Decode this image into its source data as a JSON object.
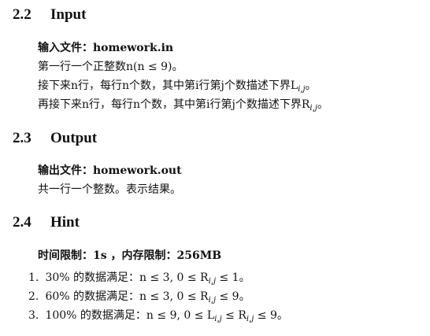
{
  "input": {
    "heading_num": "2.2",
    "heading_title": "Input",
    "file_label": "输入文件：homework.in",
    "line1": "第一行一个正整数n(n ≤ 9)。",
    "line2": "接下来n行，每行n个数，其中第i行第j个数描述下界L",
    "line2_sub": "i,j",
    "line2_end": "。",
    "line3": "再接下来n行，每行n个数，其中第i行第j个数描述下界R",
    "line3_sub": "i,j",
    "line3_end": "。"
  },
  "output": {
    "heading_num": "2.3",
    "heading_title": "Output",
    "file_label": "输出文件：homework.out",
    "line1": "共一行一个整数。表示结果。"
  },
  "hint": {
    "heading_num": "2.4",
    "heading_title": "Hint",
    "limits": "时间限制：1s ，内存限制：256MB",
    "items": [
      {
        "num": "1.",
        "pre": "30% 的数据满足：n ≤ 3, 0 ≤ R",
        "sub": "i,j",
        "post": " ≤ 1。"
      },
      {
        "num": "2.",
        "pre": "60% 的数据满足：n ≤ 3, 0 ≤ R",
        "sub": "i,j",
        "post": " ≤ 9。"
      },
      {
        "num": "3.",
        "pre": "100% 的数据满足：n ≤ 9, 0 ≤ L",
        "sub": "i,j",
        "mid": " ≤ R",
        "sub2": "i,j",
        "post": " ≤ 9。"
      }
    ]
  }
}
